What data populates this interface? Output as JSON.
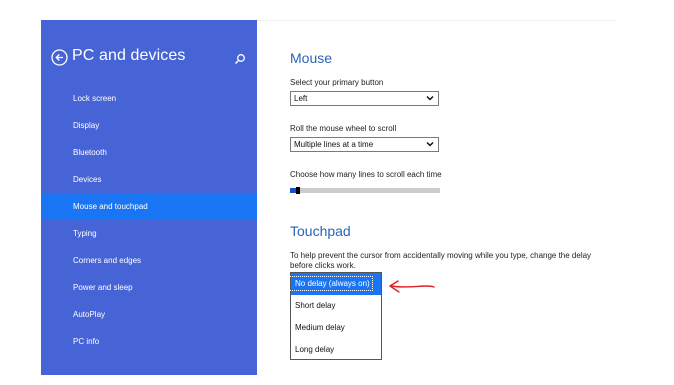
{
  "sidebar": {
    "title": "PC and devices",
    "items": [
      {
        "label": "Lock screen",
        "active": false
      },
      {
        "label": "Display",
        "active": false
      },
      {
        "label": "Bluetooth",
        "active": false
      },
      {
        "label": "Devices",
        "active": false
      },
      {
        "label": "Mouse and touchpad",
        "active": true
      },
      {
        "label": "Typing",
        "active": false
      },
      {
        "label": "Corners and edges",
        "active": false
      },
      {
        "label": "Power and sleep",
        "active": false
      },
      {
        "label": "AutoPlay",
        "active": false
      },
      {
        "label": "PC info",
        "active": false
      }
    ],
    "back_icon": "back-arrow-icon",
    "search_icon": "search-icon"
  },
  "mouse": {
    "title": "Mouse",
    "primary_button_label": "Select your primary button",
    "primary_button_value": "Left",
    "scroll_label": "Roll the mouse wheel to scroll",
    "scroll_value": "Multiple lines at a time",
    "lines_label": "Choose how many lines to scroll each time",
    "lines_slider_fraction": 0.04
  },
  "touchpad": {
    "title": "Touchpad",
    "description": "To help prevent the cursor from accidentally moving while you type, change the delay before clicks work.",
    "delay_options": [
      "No delay (always on)",
      "Short delay",
      "Medium delay",
      "Long delay"
    ],
    "selected_index": 0
  },
  "colors": {
    "sidebar_bg": "#4764d6",
    "active_item": "#1a75f5",
    "heading": "#2b62b8",
    "annotation_arrow": "#e02020"
  }
}
